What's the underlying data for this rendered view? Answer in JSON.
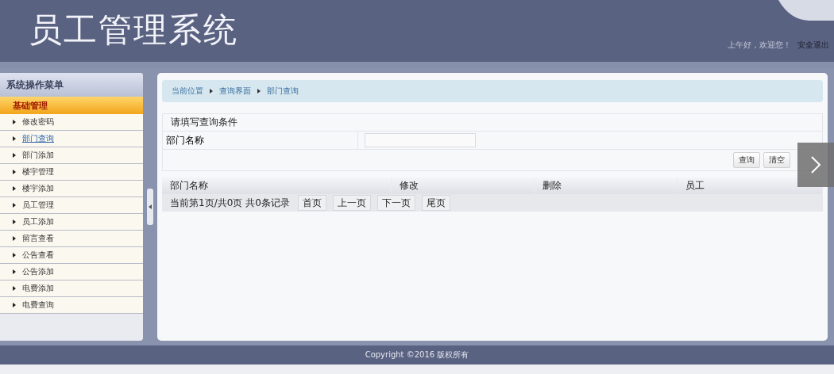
{
  "header": {
    "title": "员工管理系统",
    "greeting": "上午好，欢迎您！",
    "logout": "安全退出"
  },
  "sidebar": {
    "title": "系统操作菜单",
    "group": "基础管理",
    "items": [
      {
        "label": "修改密码",
        "selected": false
      },
      {
        "label": "部门查询",
        "selected": true
      },
      {
        "label": "部门添加",
        "selected": false
      },
      {
        "label": "楼宇管理",
        "selected": false
      },
      {
        "label": "楼宇添加",
        "selected": false
      },
      {
        "label": "员工管理",
        "selected": false
      },
      {
        "label": "员工添加",
        "selected": false
      },
      {
        "label": "留言查看",
        "selected": false
      },
      {
        "label": "公告查看",
        "selected": false
      },
      {
        "label": "公告添加",
        "selected": false
      },
      {
        "label": "电费添加",
        "selected": false
      },
      {
        "label": "电费查询",
        "selected": false
      }
    ]
  },
  "breadcrumb": [
    "当前位置",
    "查询界面",
    "部门查询"
  ],
  "form": {
    "title": "请填写查询条件",
    "field_label": "部门名称",
    "buttons": [
      "查询",
      "清空"
    ]
  },
  "table": {
    "columns": [
      "部门名称",
      "修改",
      "删除",
      "员工"
    ]
  },
  "pager": {
    "info": "当前第1页/共0页 共0条记录",
    "buttons": [
      "首页",
      "上一页",
      "下一页",
      "尾页"
    ]
  },
  "footer": "Copyright ©2016 版权所有"
}
